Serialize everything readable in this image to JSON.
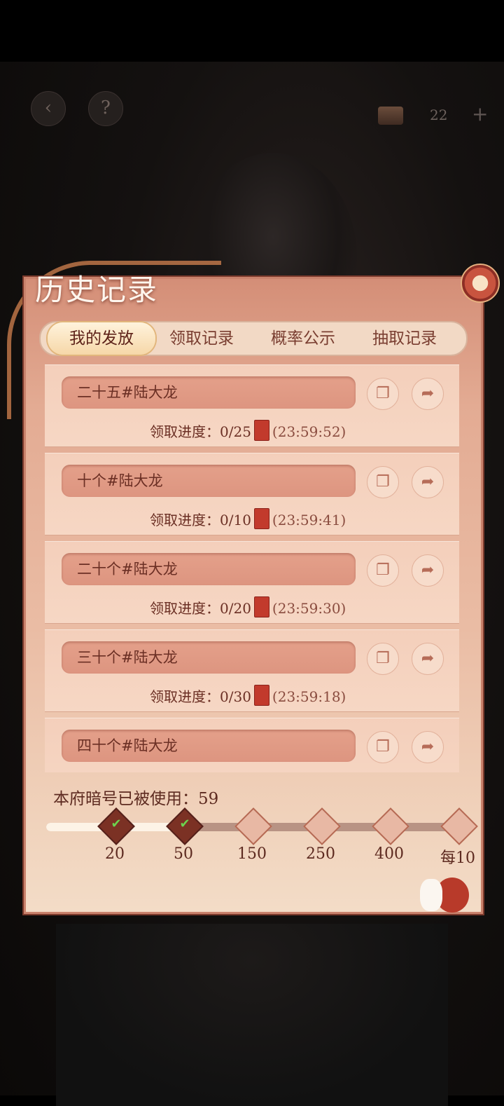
{
  "top": {
    "back_icon": "back-arrow-icon",
    "help_label": "?",
    "currency_value": "22",
    "plus_label": "+"
  },
  "panel": {
    "title": "历史记录",
    "tabs": [
      {
        "label": "我的发放",
        "active": true
      },
      {
        "label": "领取记录",
        "active": false
      },
      {
        "label": "概率公示",
        "active": false
      },
      {
        "label": "抽取记录",
        "active": false
      }
    ],
    "records": [
      {
        "name": "二十五#陆大龙",
        "progress_label": "领取进度：",
        "progress": "0/25",
        "timer": "(23:59:52)"
      },
      {
        "name": "十个#陆大龙",
        "progress_label": "领取进度：",
        "progress": "0/10",
        "timer": "(23:59:41)"
      },
      {
        "name": "二十个#陆大龙",
        "progress_label": "领取进度：",
        "progress": "0/20",
        "timer": "(23:59:30)"
      },
      {
        "name": "三十个#陆大龙",
        "progress_label": "领取进度：",
        "progress": "0/30",
        "timer": "(23:59:18)"
      },
      {
        "name": "四十个#陆大龙",
        "progress_label": "",
        "progress": "",
        "timer": ""
      }
    ],
    "usage_text": "本府暗号已被使用：59",
    "usage_value": 59,
    "milestones": [
      {
        "label": "20",
        "claimed": true
      },
      {
        "label": "50",
        "claimed": true
      },
      {
        "label": "150",
        "claimed": false
      },
      {
        "label": "250",
        "claimed": false
      },
      {
        "label": "400",
        "claimed": false
      },
      {
        "label": "每10",
        "claimed": false
      }
    ]
  },
  "colors": {
    "panel_top": "#d48e77",
    "panel_bottom": "#f3dcc7",
    "text_dark": "#6b2f24",
    "packet_red": "#c23a2c",
    "check_green": "#6cd24e"
  }
}
